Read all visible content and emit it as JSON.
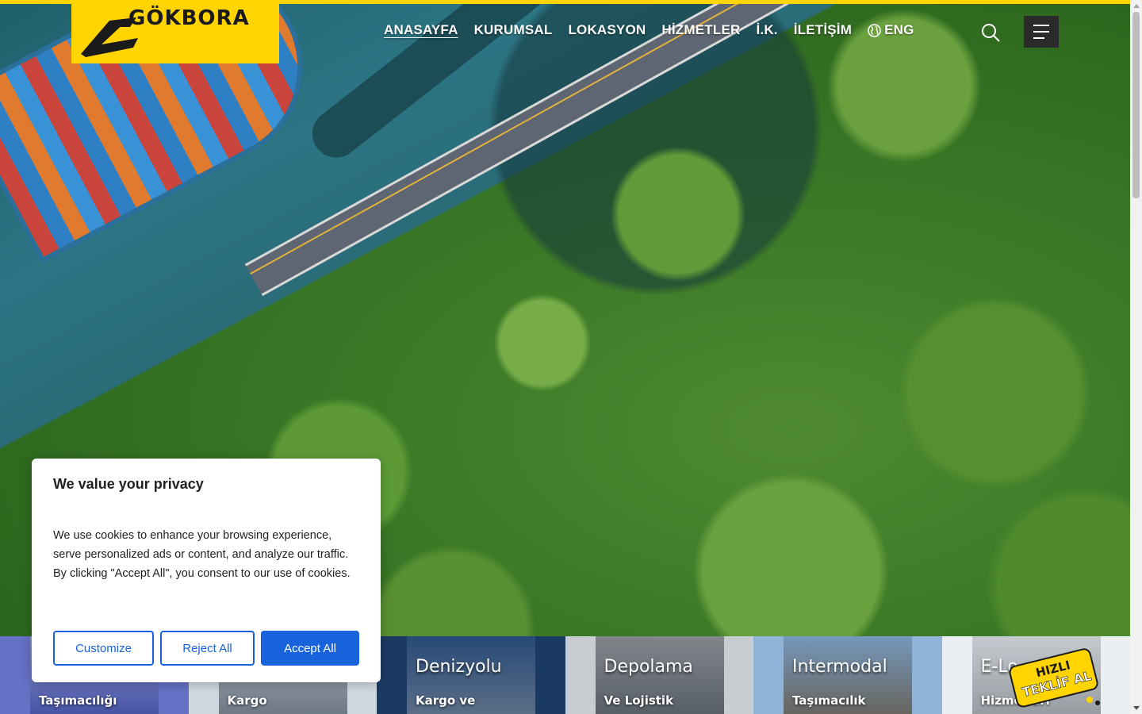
{
  "brand": {
    "name": "GÖKBORA",
    "color": "#ffd400"
  },
  "nav": {
    "items": [
      {
        "label": "ANASAYFA",
        "active": true
      },
      {
        "label": "KURUMSAL"
      },
      {
        "label": "LOKASYON"
      },
      {
        "label": "HİZMETLER"
      },
      {
        "label": "İ.K."
      },
      {
        "label": "İLETİŞİM"
      }
    ],
    "language": {
      "label": "ENG",
      "icon": "globe-icon"
    },
    "search_icon": "search-icon",
    "menu_icon": "hamburger-menu-icon"
  },
  "service_cards": [
    {
      "title": "",
      "subtitle": "Taşımacılığı"
    },
    {
      "title": "",
      "subtitle": "Kargo"
    },
    {
      "title": "Denizyolu",
      "subtitle": "Kargo ve"
    },
    {
      "title": "Depolama",
      "subtitle": "Ve Lojistik"
    },
    {
      "title": "Intermodal",
      "subtitle": "Taşımacılık"
    },
    {
      "title": "E-Lo",
      "subtitle": "Hizmetleri"
    }
  ],
  "quote_badge": {
    "line1": "HIZLI",
    "line2": "TEKLİF AL",
    "color": "#ffd400"
  },
  "cookie_banner": {
    "title": "We value your privacy",
    "body": "We use cookies to enhance your browsing experience, serve personalized ads or content, and analyze our traffic. By clicking \"Accept All\", you consent to our use of cookies.",
    "customize_label": "Customize",
    "reject_label": "Reject All",
    "accept_label": "Accept All",
    "accent_color": "#1863dc"
  }
}
